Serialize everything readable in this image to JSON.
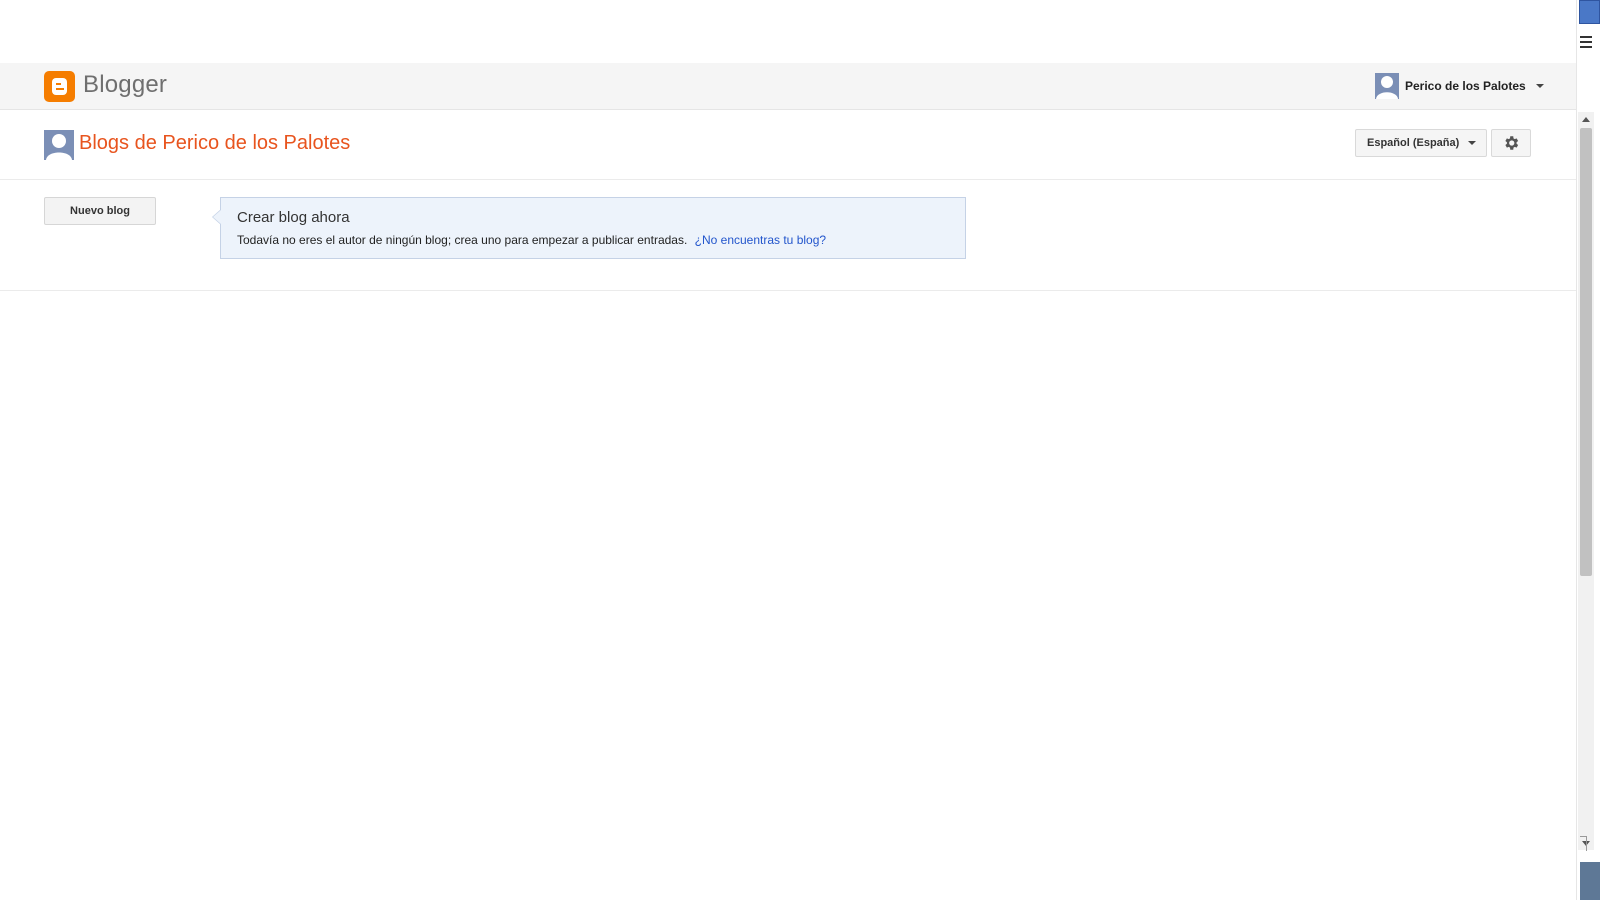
{
  "header": {
    "brand": "Blogger",
    "account_name": "Perico de los Palotes"
  },
  "title_row": {
    "page_title": "Blogs de Perico de los Palotes",
    "language_label": "Español (España)"
  },
  "content": {
    "new_blog_label": "Nuevo blog",
    "callout_title": "Crear blog ahora",
    "callout_text": "Todavía no eres el autor de ningún blog; crea uno para empezar a publicar entradas.",
    "callout_link": "¿No encuentras tu blog?"
  },
  "colors": {
    "brand_orange": "#f57d00",
    "title_orange": "#e8541e",
    "link_blue": "#2255cc",
    "callout_bg": "#edf3fb"
  },
  "icons": {
    "logo": "blogger-logo-icon",
    "avatar": "avatar-icon",
    "gear": "gear-icon",
    "caret": "chevron-down-icon"
  }
}
